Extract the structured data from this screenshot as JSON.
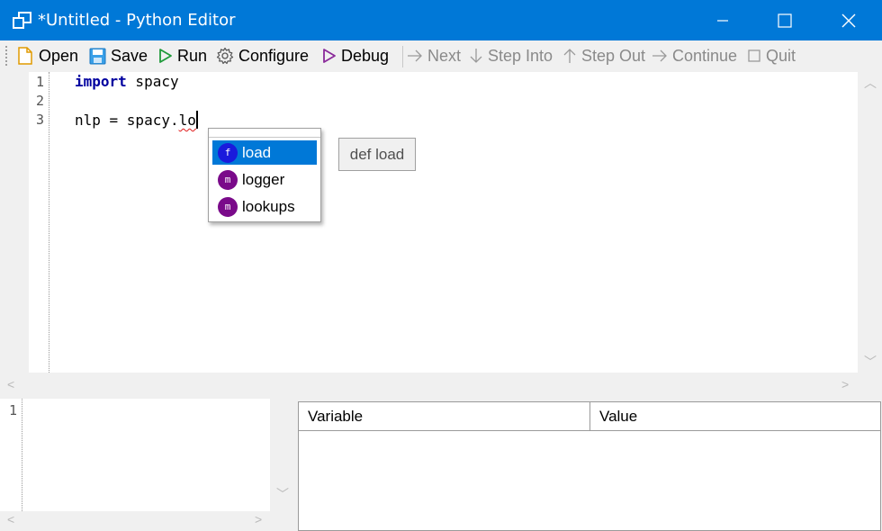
{
  "window": {
    "title": "*Untitled - Python Editor",
    "controls": [
      "minimize",
      "maximize",
      "close"
    ]
  },
  "toolbar": {
    "open": "Open",
    "save": "Save",
    "run": "Run",
    "configure": "Configure",
    "debug": "Debug",
    "next": "Next",
    "step_into": "Step Into",
    "step_out": "Step Out",
    "continue": "Continue",
    "quit": "Quit"
  },
  "editor": {
    "line_numbers": [
      "1",
      "2",
      "3"
    ],
    "line1_keyword": "import",
    "line1_rest": " spacy",
    "line3_prefix": "nlp = spacy.",
    "line3_typed": "lo"
  },
  "autocomplete": {
    "items": [
      {
        "badge": "f",
        "label": "load",
        "kind": "function",
        "selected": true
      },
      {
        "badge": "m",
        "label": "logger",
        "kind": "module"
      },
      {
        "badge": "m",
        "label": "lookups",
        "kind": "module"
      }
    ],
    "tooltip": "def load"
  },
  "console": {
    "line_numbers": [
      "1"
    ]
  },
  "variables": {
    "columns": [
      "Variable",
      "Value"
    ]
  },
  "colors": {
    "titlebar": "#0078d7",
    "selection": "#0078d7",
    "keyword": "#00009f",
    "function_badge": "#1a1adc",
    "module_badge": "#7a0a8a"
  }
}
